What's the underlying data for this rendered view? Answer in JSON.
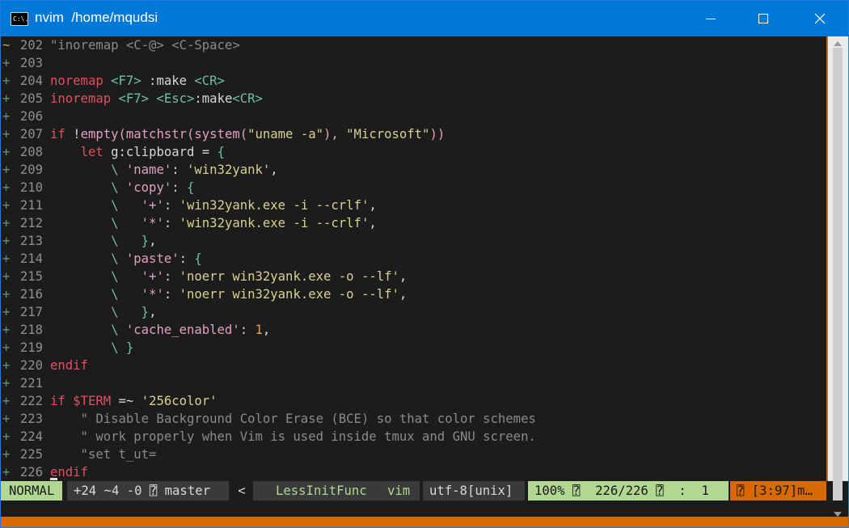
{
  "window": {
    "title": "nvim  /home/mqudsi",
    "icon": "terminal-icon",
    "icon_text": "C:\\.",
    "controls": [
      "minimize",
      "maximize",
      "close"
    ]
  },
  "editor": {
    "lines": [
      {
        "sign": "~",
        "num": "202",
        "spans": [
          {
            "t": "\"inoremap <C-@> <C-Space>",
            "c": "cmt"
          }
        ]
      },
      {
        "sign": "+",
        "num": "203",
        "spans": []
      },
      {
        "sign": "+",
        "num": "204",
        "spans": [
          {
            "t": "noremap",
            "c": "kw"
          },
          {
            "t": " "
          },
          {
            "t": "<F7>",
            "c": "fn"
          },
          {
            "t": " :make "
          },
          {
            "t": "<CR>",
            "c": "fn"
          }
        ]
      },
      {
        "sign": "+",
        "num": "205",
        "spans": [
          {
            "t": "inoremap",
            "c": "kw"
          },
          {
            "t": " "
          },
          {
            "t": "<F7>",
            "c": "fn"
          },
          {
            "t": " "
          },
          {
            "t": "<Esc>",
            "c": "fn"
          },
          {
            "t": ":make"
          },
          {
            "t": "<CR>",
            "c": "fn"
          }
        ]
      },
      {
        "sign": "+",
        "num": "206",
        "spans": []
      },
      {
        "sign": "+",
        "num": "207",
        "spans": [
          {
            "t": "if",
            "c": "kw"
          },
          {
            "t": " !"
          },
          {
            "t": "empty(matchstr(system(",
            "c": "key"
          },
          {
            "t": "\"uname -a\"",
            "c": "str"
          },
          {
            "t": "), ",
            "c": "key"
          },
          {
            "t": "\"Microsoft\"",
            "c": "str"
          },
          {
            "t": "))",
            "c": "key"
          }
        ]
      },
      {
        "sign": "+",
        "num": "208",
        "spans": [
          {
            "t": "    "
          },
          {
            "t": "let",
            "c": "kw"
          },
          {
            "t": " g:clipboard = "
          },
          {
            "t": "{",
            "c": "fn"
          }
        ]
      },
      {
        "sign": "+",
        "num": "209",
        "spans": [
          {
            "t": "        "
          },
          {
            "t": "\\",
            "c": "fn"
          },
          {
            "t": " 'name'",
            "c": "key"
          },
          {
            "t": ": "
          },
          {
            "t": "'win32yank'",
            "c": "str"
          },
          {
            "t": ","
          }
        ]
      },
      {
        "sign": "+",
        "num": "210",
        "spans": [
          {
            "t": "        "
          },
          {
            "t": "\\",
            "c": "fn"
          },
          {
            "t": " 'copy'",
            "c": "key"
          },
          {
            "t": ": "
          },
          {
            "t": "{",
            "c": "fn"
          }
        ]
      },
      {
        "sign": "+",
        "num": "211",
        "spans": [
          {
            "t": "        "
          },
          {
            "t": "\\",
            "c": "fn"
          },
          {
            "t": "   '+'",
            "c": "key"
          },
          {
            "t": ": "
          },
          {
            "t": "'win32yank.exe -i --crlf'",
            "c": "str"
          },
          {
            "t": ","
          }
        ]
      },
      {
        "sign": "+",
        "num": "212",
        "spans": [
          {
            "t": "        "
          },
          {
            "t": "\\",
            "c": "fn"
          },
          {
            "t": "   '*'",
            "c": "key"
          },
          {
            "t": ": "
          },
          {
            "t": "'win32yank.exe -i --crlf'",
            "c": "str"
          },
          {
            "t": ","
          }
        ]
      },
      {
        "sign": "+",
        "num": "213",
        "spans": [
          {
            "t": "        "
          },
          {
            "t": "\\",
            "c": "fn"
          },
          {
            "t": "   "
          },
          {
            "t": "}",
            "c": "fn"
          },
          {
            "t": ","
          }
        ]
      },
      {
        "sign": "+",
        "num": "214",
        "spans": [
          {
            "t": "        "
          },
          {
            "t": "\\",
            "c": "fn"
          },
          {
            "t": " 'paste'",
            "c": "key"
          },
          {
            "t": ": "
          },
          {
            "t": "{",
            "c": "fn"
          }
        ]
      },
      {
        "sign": "+",
        "num": "215",
        "spans": [
          {
            "t": "        "
          },
          {
            "t": "\\",
            "c": "fn"
          },
          {
            "t": "   '+'",
            "c": "key"
          },
          {
            "t": ": "
          },
          {
            "t": "'noerr win32yank.exe -o --lf'",
            "c": "str"
          },
          {
            "t": ","
          }
        ]
      },
      {
        "sign": "+",
        "num": "216",
        "spans": [
          {
            "t": "        "
          },
          {
            "t": "\\",
            "c": "fn"
          },
          {
            "t": "   '*'",
            "c": "key"
          },
          {
            "t": ": "
          },
          {
            "t": "'noerr win32yank.exe -o --lf'",
            "c": "str"
          },
          {
            "t": ","
          }
        ]
      },
      {
        "sign": "+",
        "num": "217",
        "spans": [
          {
            "t": "        "
          },
          {
            "t": "\\",
            "c": "fn"
          },
          {
            "t": "   "
          },
          {
            "t": "}",
            "c": "fn"
          },
          {
            "t": ","
          }
        ]
      },
      {
        "sign": "+",
        "num": "218",
        "spans": [
          {
            "t": "        "
          },
          {
            "t": "\\",
            "c": "fn"
          },
          {
            "t": " 'cache_enabled'",
            "c": "key"
          },
          {
            "t": ": "
          },
          {
            "t": "1",
            "c": "num"
          },
          {
            "t": ","
          }
        ]
      },
      {
        "sign": "+",
        "num": "219",
        "spans": [
          {
            "t": "        "
          },
          {
            "t": "\\",
            "c": "fn"
          },
          {
            "t": " "
          },
          {
            "t": "}",
            "c": "fn"
          }
        ]
      },
      {
        "sign": "+",
        "num": "220",
        "spans": [
          {
            "t": "endif",
            "c": "kw"
          }
        ]
      },
      {
        "sign": "+",
        "num": "221",
        "spans": []
      },
      {
        "sign": "+",
        "num": "222",
        "spans": [
          {
            "t": "if",
            "c": "kw"
          },
          {
            "t": " "
          },
          {
            "t": "$TERM",
            "c": "kw"
          },
          {
            "t": " =~ "
          },
          {
            "t": "'256color'",
            "c": "str"
          }
        ]
      },
      {
        "sign": "+",
        "num": "223",
        "spans": [
          {
            "t": "    \" Disable Background Color Erase (BCE) so that color schemes",
            "c": "cmt"
          }
        ]
      },
      {
        "sign": "+",
        "num": "224",
        "spans": [
          {
            "t": "    \" work properly when Vim is used inside tmux and GNU screen.",
            "c": "cmt"
          }
        ]
      },
      {
        "sign": "+",
        "num": "225",
        "spans": [
          {
            "t": "    \"set t_ut=",
            "c": "cmt"
          }
        ]
      },
      {
        "sign": "+",
        "num": "226",
        "spans": [
          {
            "t": "endif",
            "c": "kw"
          }
        ]
      }
    ]
  },
  "statusline": {
    "mode": "NORMAL",
    "git": "+24 ~4 -0 ⍰ master",
    "separator": "<",
    "function": "LessInitFunc",
    "filetype": "vim",
    "encoding": "utf-8[unix]",
    "position": "100% ⍰  226/226 ⍰  :  1",
    "warning": "⍰ [3:97]m…"
  },
  "colors": {
    "titlebar": "#0078d7",
    "background": "#1c1c1c",
    "accent_orange": "#d86800",
    "mode_green": "#b0d890"
  }
}
